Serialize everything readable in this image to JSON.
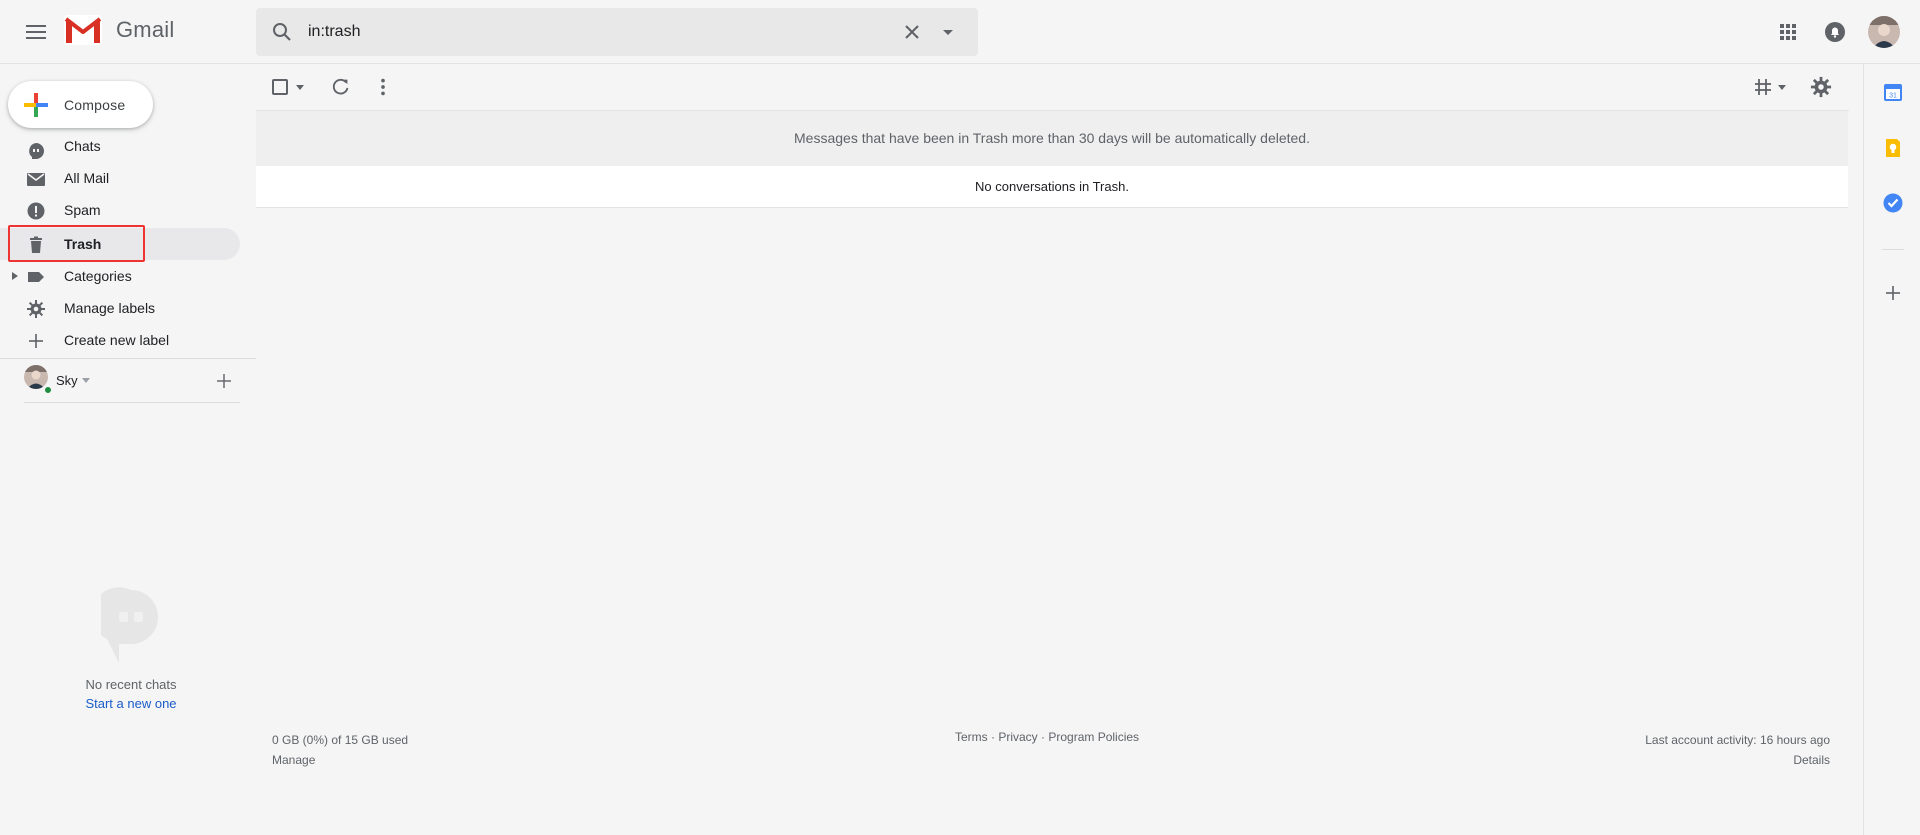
{
  "app": {
    "name": "Gmail"
  },
  "search": {
    "value": "in:trash"
  },
  "compose": {
    "label": "Compose"
  },
  "sidebar": {
    "items": [
      {
        "label": "Chats",
        "icon": "chat-icon"
      },
      {
        "label": "All Mail",
        "icon": "mail-icon"
      },
      {
        "label": "Spam",
        "icon": "spam-icon"
      },
      {
        "label": "Trash",
        "icon": "trash-icon",
        "active": true
      },
      {
        "label": "Categories",
        "icon": "label-icon"
      },
      {
        "label": "Manage labels",
        "icon": "gear-icon"
      },
      {
        "label": "Create new label",
        "icon": "plus-icon"
      }
    ]
  },
  "hangouts": {
    "user": "Sky",
    "status": "online",
    "no_chats": "No recent chats",
    "start_new": "Start a new one"
  },
  "main": {
    "trash_notice": "Messages that have been in Trash more than 30 days will be automatically deleted.",
    "empty_message": "No conversations in Trash."
  },
  "footer": {
    "storage": "0 GB (0%) of 15 GB used",
    "manage": "Manage",
    "terms": "Terms",
    "privacy": "Privacy",
    "program_policies": "Program Policies",
    "separator": " · ",
    "last_activity": "Last account activity: 16 hours ago",
    "details": "Details"
  },
  "colors": {
    "highlight_box": "#e33333",
    "link": "#1a5dc9",
    "online": "#1e8e3e",
    "gmail_red": "#d93025"
  }
}
